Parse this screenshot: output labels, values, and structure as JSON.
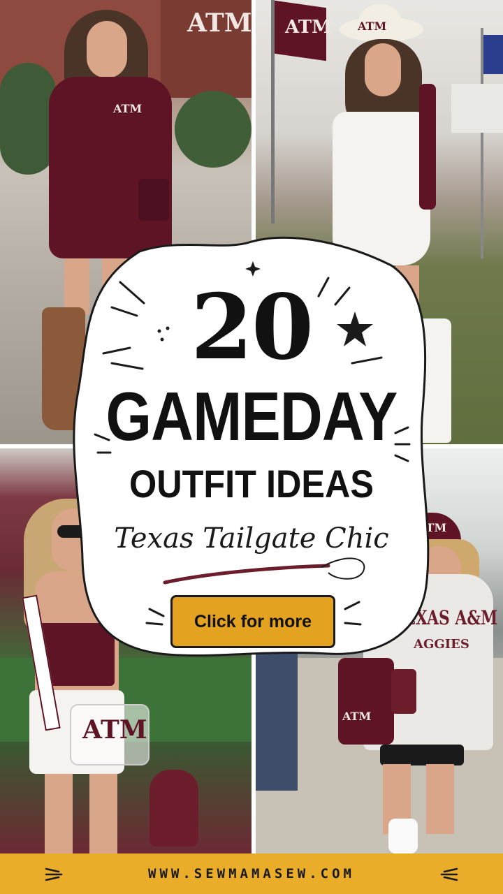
{
  "headline": {
    "number": "20",
    "line1": "GAMEDAY",
    "line2": "OUTFIT IDEAS",
    "tagline": "Texas Tailgate Chic"
  },
  "cta": {
    "label": "Click for more"
  },
  "footer": {
    "url": "WWW.SEWMAMASEW.COM"
  },
  "photos": {
    "top_left": {
      "logo": "ATM"
    },
    "top_right": {
      "logo": "ATM"
    },
    "bottom_left": {
      "logo": "ATM"
    },
    "bottom_right": {
      "logo": "ATM",
      "shirt_line1": "TEXAS A&M",
      "shirt_line2": "AGGIES"
    }
  },
  "colors": {
    "maroon": "#5e1424",
    "gold": "#e3a21f",
    "footer": "#e9ad2a",
    "ink": "#111111"
  }
}
